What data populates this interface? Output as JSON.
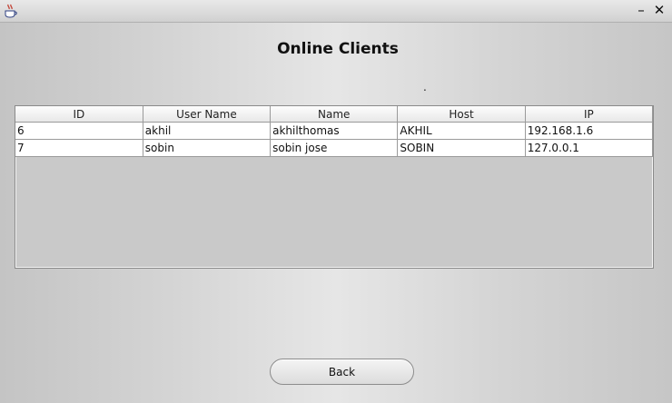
{
  "window": {
    "minimize_glyph": "–",
    "close_glyph": "✕",
    "app_icon": "java-coffee-cup-icon"
  },
  "header": {
    "title": "Online Clients",
    "status_label": "."
  },
  "clients_table": {
    "columns": [
      "ID",
      "User Name",
      "Name",
      "Host",
      "IP"
    ],
    "rows": [
      [
        "6",
        "akhil",
        "akhilthomas",
        "AKHIL",
        "192.168.1.6"
      ],
      [
        "7",
        "sobin",
        "sobin jose",
        "SOBIN",
        "127.0.0.1"
      ]
    ]
  },
  "footer": {
    "back_label": "Back"
  },
  "colors": {
    "table_background": "#c9c9c9",
    "row_background": "#ffffff"
  }
}
